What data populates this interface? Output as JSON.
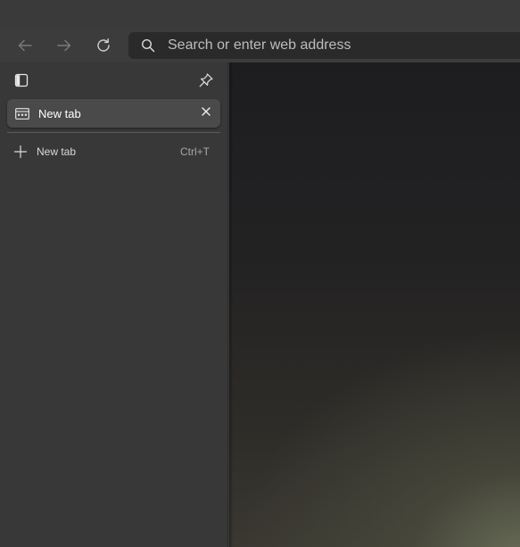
{
  "toolbar": {
    "back_icon": "arrow-left-icon",
    "forward_icon": "arrow-right-icon",
    "refresh_icon": "refresh-icon",
    "address": {
      "placeholder": "Search or enter web address",
      "value": "",
      "icon": "search-icon"
    }
  },
  "sidebar": {
    "toggle_icon": "sidebar-panel-icon",
    "pin_icon": "pin-icon",
    "tabs": [
      {
        "title": "New tab",
        "favicon": "new-tab-page-icon",
        "close_icon": "close-icon",
        "active": true
      }
    ],
    "new_tab": {
      "label": "New tab",
      "shortcut": "Ctrl+T",
      "icon": "plus-icon"
    }
  },
  "colors": {
    "toolbar_bg": "#3c3c3c",
    "sidebar_bg": "#383838",
    "active_tab_bg": "#4a4a4a",
    "addressbar_bg": "#2a2a2a"
  }
}
